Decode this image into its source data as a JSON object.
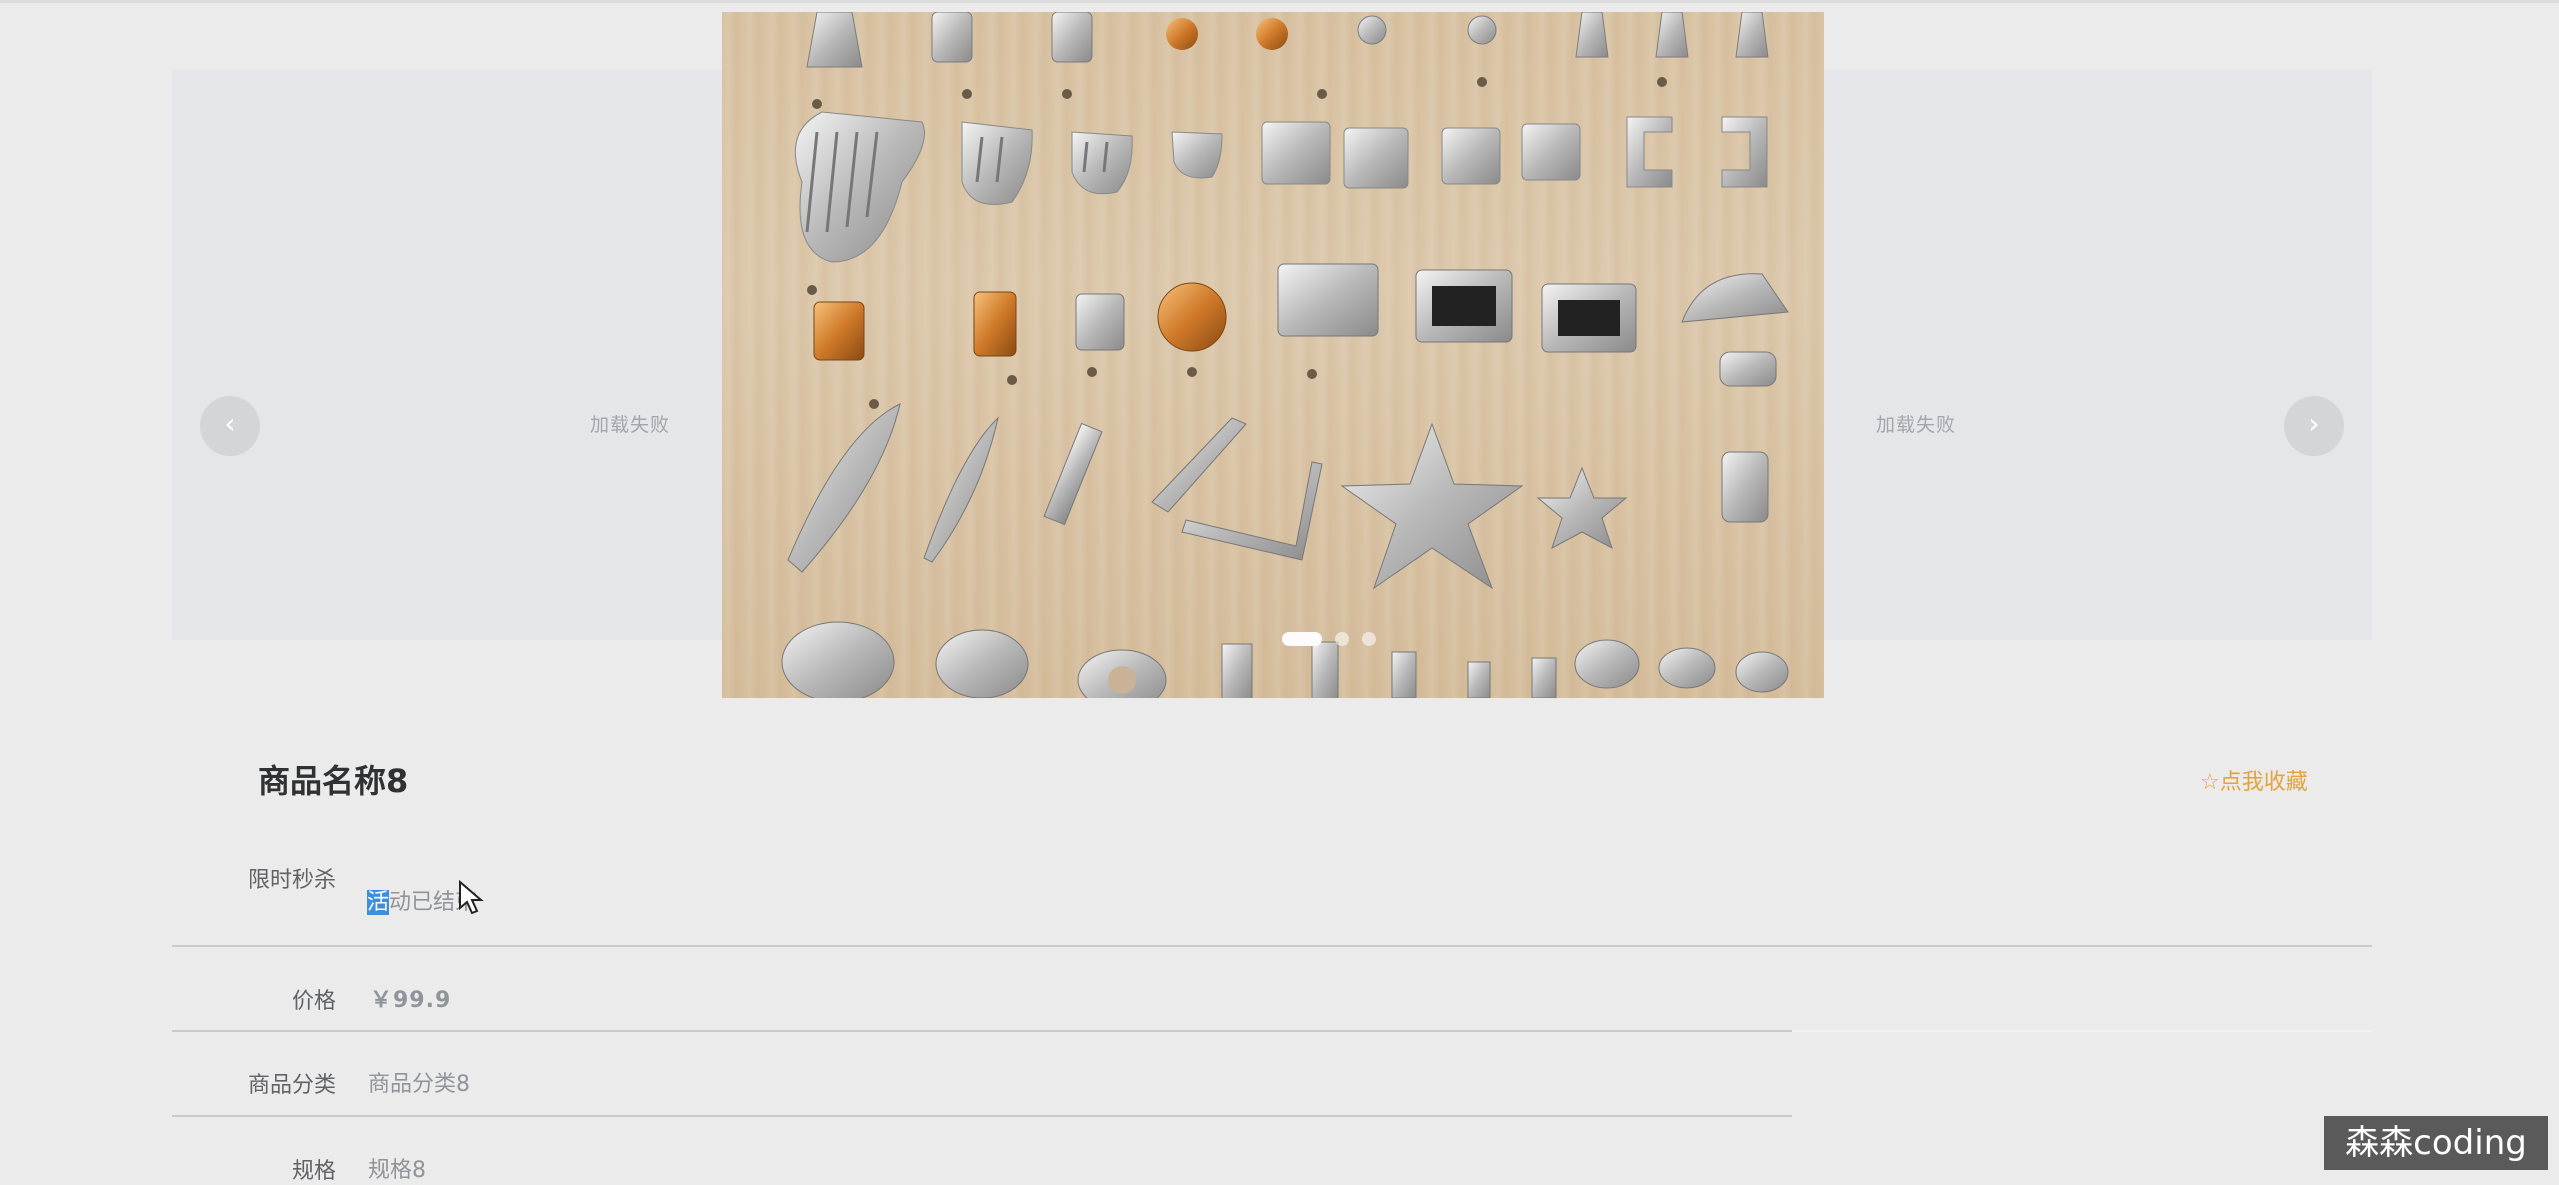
{
  "carousel": {
    "load_failed_left": "加载失败",
    "load_failed_right": "加载失败",
    "prev_arrow": "‹",
    "next_arrow": "›",
    "slide_count": 3,
    "active_slide": 1
  },
  "product": {
    "name": "商品名称8",
    "favorite_label": "☆点我收藏"
  },
  "details": {
    "flash_sale_label": "限时秒杀",
    "flash_sale_status_selected": "活",
    "flash_sale_status_rest": "动已结束",
    "price_label": "价格",
    "price_value": "￥99.9",
    "category_label": "商品分类",
    "category_value": "商品分类8",
    "spec_label": "规格",
    "spec_value": "规格8"
  },
  "watermark": "森森coding",
  "colors": {
    "favorite": "#e6a23c",
    "selection": "#3e8ede",
    "label": "#606266",
    "value": "#909399"
  }
}
